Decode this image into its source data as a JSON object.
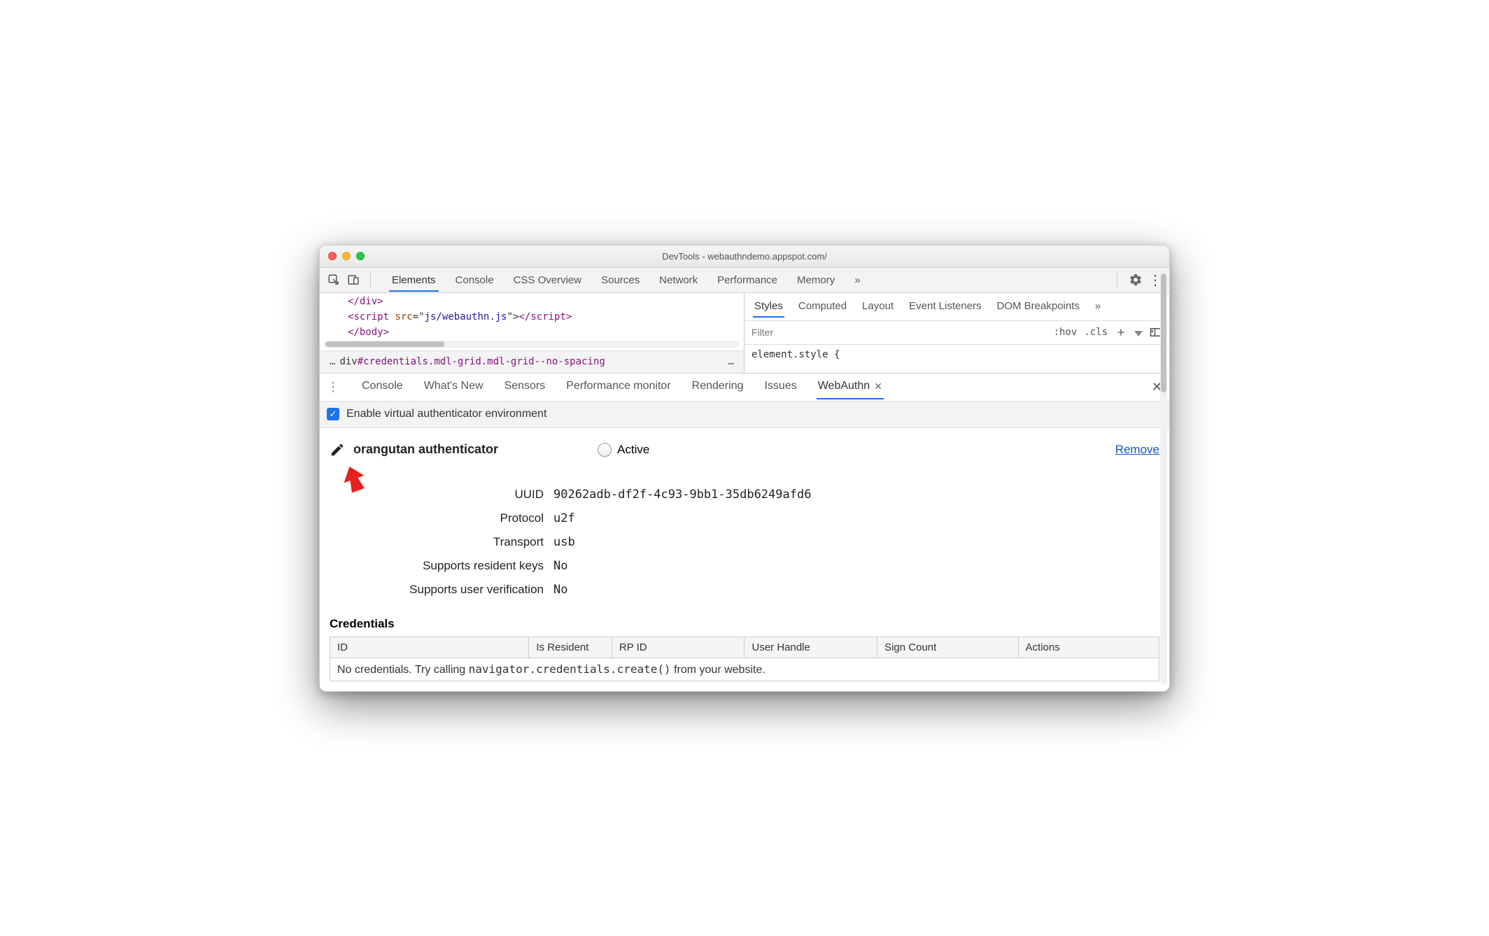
{
  "window": {
    "title": "DevTools - webauthndemo.appspot.com/"
  },
  "topTabs": {
    "items": [
      "Elements",
      "Console",
      "CSS Overview",
      "Sources",
      "Network",
      "Performance",
      "Memory"
    ],
    "overflow": "»",
    "activeIndex": 0
  },
  "code": {
    "line1_open": "</",
    "line1_tag": "div",
    "line1_close": ">",
    "line2_open": "<",
    "line2_tag": "script",
    "line2_sp": " ",
    "line2_attr": "src",
    "line2_eq": "=\"",
    "line2_str": "js/webauthn.js",
    "line2_eq2": "\">",
    "line2_openclose": "</",
    "line2_tag2": "script",
    "line2_close2": ">",
    "line3_open": "</",
    "line3_tag": "body",
    "line3_close": ">"
  },
  "breadcrumb": {
    "dotsL": "…",
    "part1": "div",
    "part2": "#credentials",
    "part3": ".mdl-grid",
    "part4": ".mdl-grid--no-spacing",
    "dotsR": "…"
  },
  "rightTabs": {
    "items": [
      "Styles",
      "Computed",
      "Layout",
      "Event Listeners",
      "DOM Breakpoints"
    ],
    "overflow": "»",
    "activeIndex": 0
  },
  "stylesBar": {
    "filterPlaceholder": "Filter",
    "hov": ":hov",
    "cls": ".cls"
  },
  "elementStyle": "element.style {",
  "drawerTabs": {
    "items": [
      "Console",
      "What's New",
      "Sensors",
      "Performance monitor",
      "Rendering",
      "Issues",
      "WebAuthn"
    ],
    "activeIndex": 6
  },
  "enableBar": {
    "label": "Enable virtual authenticator environment",
    "checked": true
  },
  "authenticator": {
    "name": "orangutan authenticator",
    "activeLabel": "Active",
    "removeLabel": "Remove",
    "props": [
      {
        "label": "UUID",
        "value": "90262adb-df2f-4c93-9bb1-35db6249afd6"
      },
      {
        "label": "Protocol",
        "value": "u2f"
      },
      {
        "label": "Transport",
        "value": "usb"
      },
      {
        "label": "Supports resident keys",
        "value": "No"
      },
      {
        "label": "Supports user verification",
        "value": "No"
      }
    ]
  },
  "credentials": {
    "title": "Credentials",
    "headers": [
      "ID",
      "Is Resident",
      "RP ID",
      "User Handle",
      "Sign Count",
      "Actions"
    ],
    "emptyPrefix": "No credentials. Try calling ",
    "emptyCode": "navigator.credentials.create()",
    "emptySuffix": " from your website."
  }
}
